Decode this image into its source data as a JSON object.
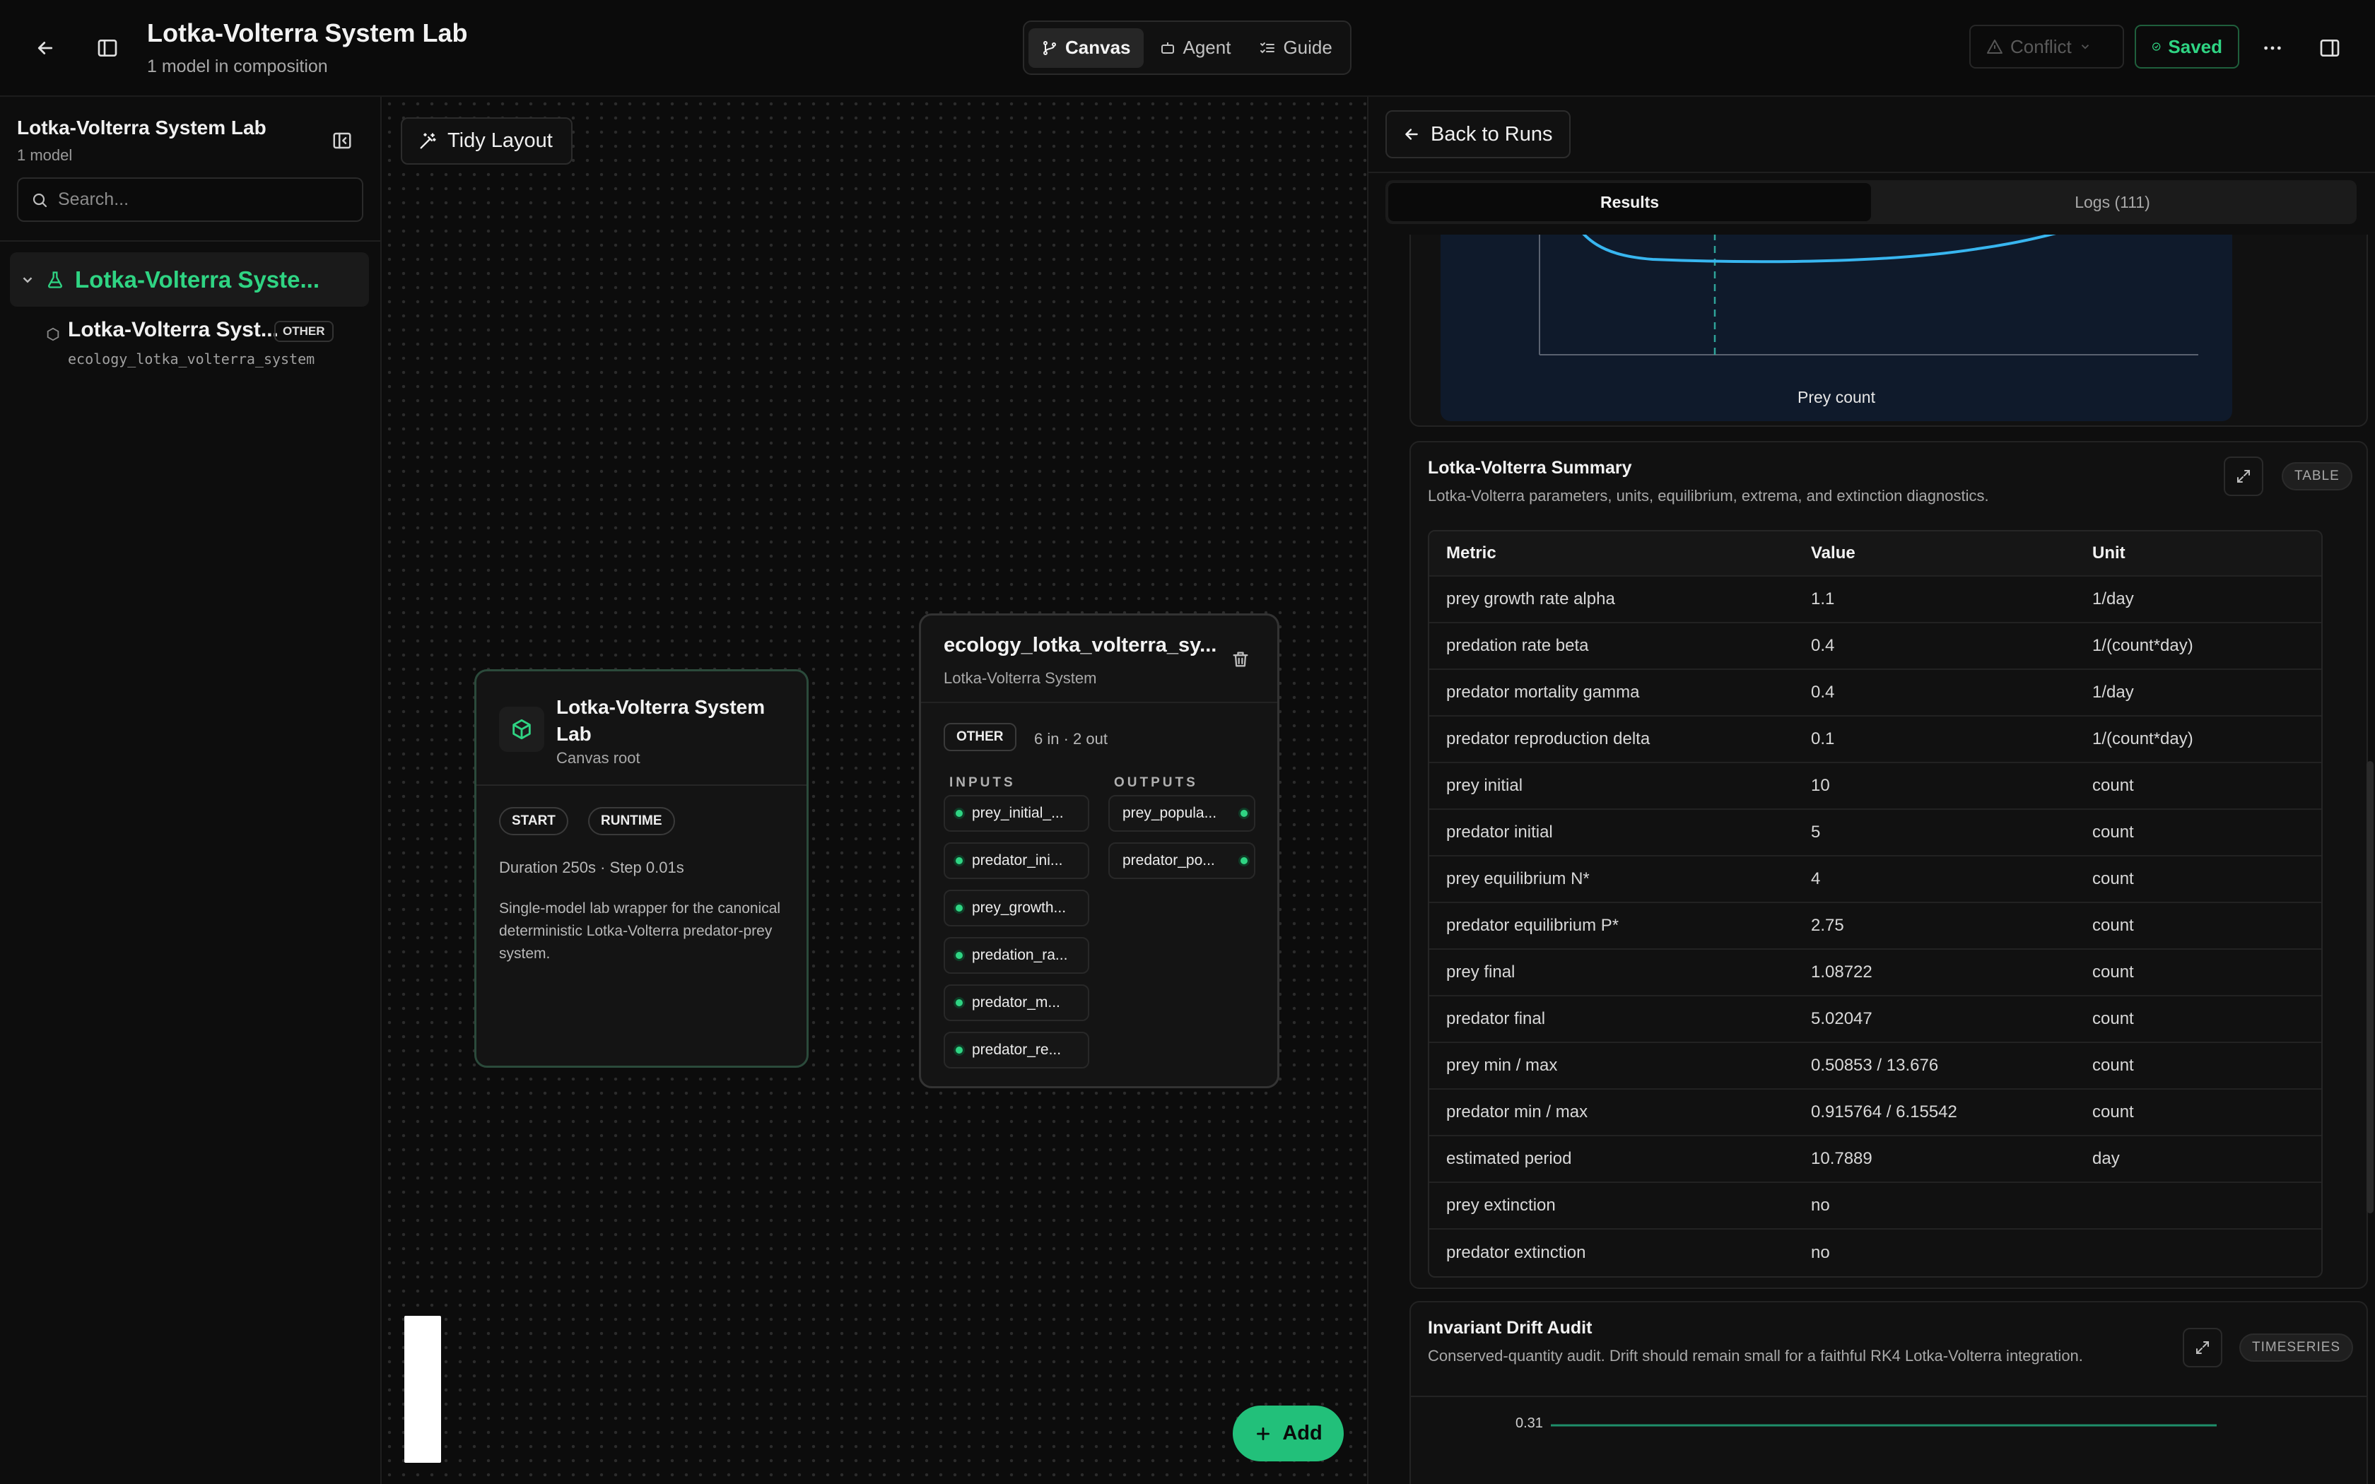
{
  "header": {
    "title": "Lotka-Volterra System Lab",
    "subtitle": "1 model in composition",
    "tabs": [
      {
        "label": "Canvas",
        "icon": "branch-icon",
        "active": true
      },
      {
        "label": "Agent",
        "icon": "robot-icon",
        "active": false
      },
      {
        "label": "Guide",
        "icon": "list-check-icon",
        "active": false
      }
    ],
    "conflict_label": "Conflict",
    "saved_label": "Saved"
  },
  "sidebar": {
    "title": "Lotka-Volterra System Lab",
    "subtitle": "1 model",
    "search_placeholder": "Search...",
    "group_label": "Lotka-Volterra Syste...",
    "item": {
      "name": "Lotka-Volterra Syst...",
      "badge": "OTHER",
      "id": "ecology_lotka_volterra_system"
    }
  },
  "canvas": {
    "tidy_label": "Tidy Layout",
    "add_label": "Add",
    "root_node": {
      "title": "Lotka-Volterra System Lab",
      "subtitle": "Canvas root",
      "tags": [
        "START",
        "RUNTIME"
      ],
      "meta": "Duration 250s · Step 0.01s",
      "description": "Single-model lab wrapper for the canonical deterministic Lotka-Volterra predator-prey system."
    },
    "model_node": {
      "title": "ecology_lotka_volterra_sy...",
      "subtitle": "Lotka-Volterra System",
      "badge": "OTHER",
      "io_summary": "6 in · 2 out",
      "inputs_label": "INPUTS",
      "outputs_label": "OUTPUTS",
      "inputs": [
        "prey_initial_...",
        "predator_ini...",
        "prey_growth...",
        "predation_ra...",
        "predator_m...",
        "predator_re..."
      ],
      "outputs": [
        "prey_popula...",
        "predator_po..."
      ]
    }
  },
  "panel": {
    "back_label": "Back to Runs",
    "tabs": [
      "Results",
      "Logs (111)"
    ],
    "phase_plot": {
      "xlabel": "Prey count"
    },
    "summary": {
      "title": "Lotka-Volterra Summary",
      "description": "Lotka-Volterra parameters, units, equilibrium, extrema, and extinction diagnostics.",
      "type_badge": "TABLE",
      "columns": [
        "Metric",
        "Value",
        "Unit"
      ],
      "rows": [
        [
          "prey growth rate alpha",
          "1.1",
          "1/day"
        ],
        [
          "predation rate beta",
          "0.4",
          "1/(count*day)"
        ],
        [
          "predator mortality gamma",
          "0.4",
          "1/day"
        ],
        [
          "predator reproduction delta",
          "0.1",
          "1/(count*day)"
        ],
        [
          "prey initial",
          "10",
          "count"
        ],
        [
          "predator initial",
          "5",
          "count"
        ],
        [
          "prey equilibrium N*",
          "4",
          "count"
        ],
        [
          "predator equilibrium P*",
          "2.75",
          "count"
        ],
        [
          "prey final",
          "1.08722",
          "count"
        ],
        [
          "predator final",
          "5.02047",
          "count"
        ],
        [
          "prey min / max",
          "0.50853 / 13.676",
          "count"
        ],
        [
          "predator min / max",
          "0.915764 / 6.15542",
          "count"
        ],
        [
          "estimated period",
          "10.7889",
          "day"
        ],
        [
          "prey extinction",
          "no",
          ""
        ],
        [
          "predator extinction",
          "no",
          ""
        ]
      ]
    },
    "drift": {
      "title": "Invariant Drift Audit",
      "description": "Conserved-quantity audit. Drift should remain small for a faithful RK4 Lotka-Volterra integration.",
      "type_badge": "TIMESERIES",
      "y_tick": "0.31"
    }
  },
  "colors": {
    "accent_green": "#2fd483",
    "plot_line": "#38b6f0",
    "plot_bg": "#0f1a2b"
  }
}
